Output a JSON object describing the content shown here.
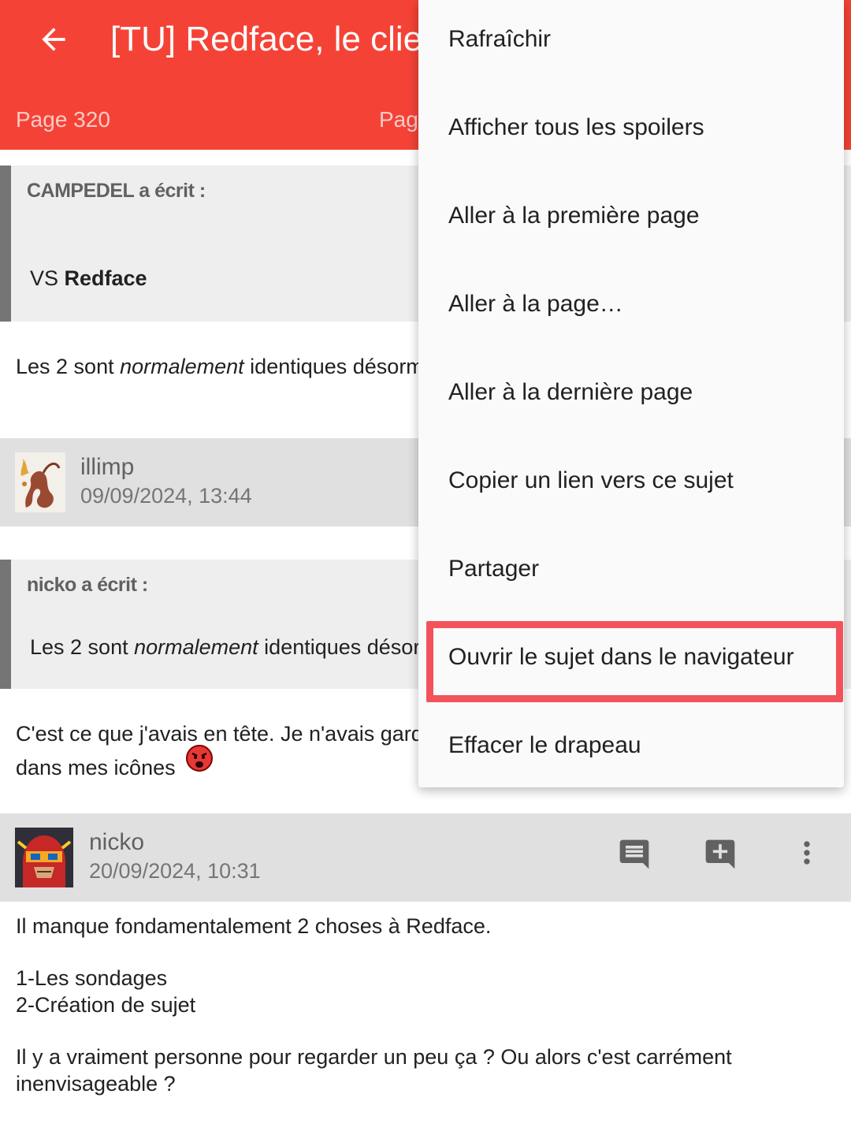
{
  "appbar": {
    "title": "[TU] Redface, le client Android pour HFR",
    "page_left": "Page 320",
    "page_right": "Page"
  },
  "posts": {
    "quote1": {
      "author": "CAMPEDEL a écrit :",
      "text_prefix": "VS ",
      "text_bold": "Redface"
    },
    "reply1": {
      "prefix": "Les 2 sont ",
      "italic": "normalement",
      "suffix": " identiques désormais"
    },
    "post2": {
      "author": "illimp",
      "date": "09/09/2024, 13:44"
    },
    "quote2": {
      "author": "nicko a écrit :",
      "prefix": "Les 2 sont ",
      "italic": "normalement",
      "suffix": " identiques désormais"
    },
    "reply2": {
      "line1": "C'est ce que j'avais en tête. Je n'avais garde",
      "line2": "dans mes icônes"
    },
    "post3": {
      "author": "nicko",
      "date": "20/09/2024, 10:31",
      "line1": "Il manque fondamentalement 2 choses à Redface.",
      "line2": "1-Les sondages",
      "line3": "2-Création de sujet",
      "line4": "Il y a vraiment personne pour regarder un peu ça ? Ou alors c'est carrément",
      "line5": "inenvisageable ?"
    }
  },
  "menu": {
    "items": [
      "Rafraîchir",
      "Afficher tous les spoilers",
      "Aller à la première page",
      "Aller à la page…",
      "Aller à la dernière page",
      "Copier un lien vers ce sujet",
      "Partager",
      "Ouvrir le sujet dans le navigateur",
      "Effacer le drapeau"
    ],
    "highlighted_index": 7
  },
  "icons": {
    "back": "arrow-back-icon",
    "quote": "comment-icon",
    "add_quote": "add-comment-icon",
    "more": "more-vert-icon"
  },
  "colors": {
    "appbar": "#f44336",
    "highlight": "#f2535b"
  }
}
